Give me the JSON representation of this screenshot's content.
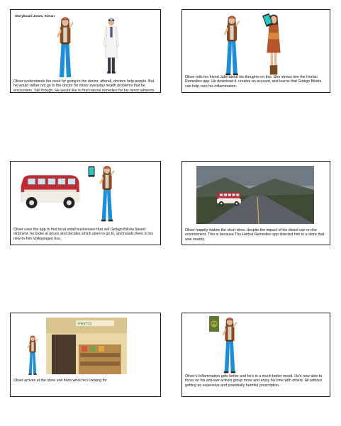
{
  "header": "Storyboard  Jones, Kieran",
  "colors": {
    "jeans": "#1e8fd6",
    "vest": "#8a4b22",
    "skin": "#e8b896",
    "van_red": "#c22b33",
    "road": "#5b5f66"
  },
  "panels": [
    {
      "caption": "Oliver understands the need for going to the doctor, afterall, doctors help people. But he would rather not go to the doctor for minor everyday health problems that he encounters. Still though, He would like to find natural remedies for his minor ailments."
    },
    {
      "caption": "Oliver tells his friend Julie about his thoughts on this. She shows him the Herbal Remedies app. He download it, creates an account, and learns that Ginkgo Biloba can help cure his inflammation."
    },
    {
      "caption": "Oliver uses the app to find local small businesses that sell Ginkgo Biloba based ointment, he looks at prices and decides which store to go to, and heads there in his new-to-him Volkswagen bus."
    },
    {
      "caption": "Oliver happily makes the short drive, despite the impact of his diesel van on the environment. This is because The Herbal Remedies app directed him to a store that was nearby."
    },
    {
      "caption": "Oliver arrives at the store and finds what he's looking for",
      "store_sign": "PHYTO"
    },
    {
      "caption": "Oliver's Inflammation gets better and he's in a much better mood. He's now able to focus on his anti-war activist group more and enjoy his time with others. All without getting an expensive and potentially harmful prescription."
    }
  ]
}
